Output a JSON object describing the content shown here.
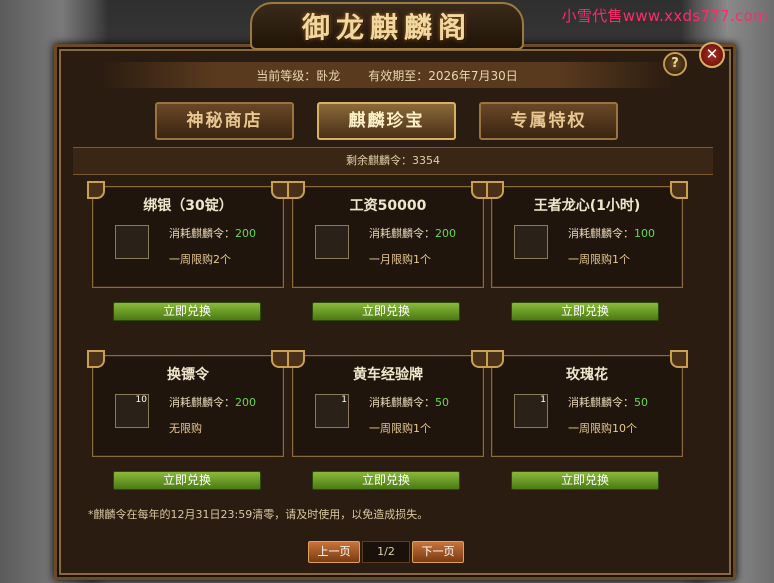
{
  "watermark": "小雪代售www.xxds777.com",
  "window": {
    "title": "御龙麒麟阁",
    "help_label": "?",
    "close_label": "✕"
  },
  "info": {
    "level_label": "当前等级：卧龙",
    "expiry_label": "有效期至：2026年7月30日"
  },
  "tabs": [
    {
      "label": "神秘商店",
      "active": false
    },
    {
      "label": "麒麟珍宝",
      "active": true
    },
    {
      "label": "专属特权",
      "active": false
    }
  ],
  "remaining": "剩余麒麟令：3354",
  "items": [
    {
      "name": "绑银（30锭）",
      "icon": "silver-ingot-icon",
      "qty": "",
      "cost_label": "消耗麒麟令：",
      "cost": "200",
      "limit": "一周限购2个",
      "button": "立即兑换"
    },
    {
      "name": "工资50000",
      "icon": "gold-salary-icon",
      "qty": "",
      "cost_label": "消耗麒麟令：",
      "cost": "200",
      "limit": "一月限购1个",
      "button": "立即兑换"
    },
    {
      "name": "王者龙心(1小时)",
      "icon": "dragon-heart-icon",
      "qty": "",
      "cost_label": "消耗麒麟令：",
      "cost": "100",
      "limit": "一周限购1个",
      "button": "立即兑换"
    },
    {
      "name": "换镖令",
      "icon": "escort-token-icon",
      "qty": "10",
      "cost_label": "消耗麒麟令：",
      "cost": "200",
      "limit": "无限购",
      "button": "立即兑换"
    },
    {
      "name": "黄车经验牌",
      "icon": "yellow-cart-icon",
      "qty": "1",
      "cost_label": "消耗麒麟令：",
      "cost": "50",
      "limit": "一周限购1个",
      "button": "立即兑换"
    },
    {
      "name": "玫瑰花",
      "icon": "rose-icon",
      "qty": "1",
      "cost_label": "消耗麒麟令：",
      "cost": "50",
      "limit": "一周限购10个",
      "button": "立即兑换"
    }
  ],
  "note": "*麒麟令在每年的12月31日23:59清零，请及时使用，以免造成损失。",
  "pager": {
    "prev": "上一页",
    "page": "1/2",
    "next": "下一页"
  },
  "colors": {
    "cost_value": "#6ad84a",
    "redeem_button": "#6a9a22",
    "pager_button": "#b05a28"
  }
}
